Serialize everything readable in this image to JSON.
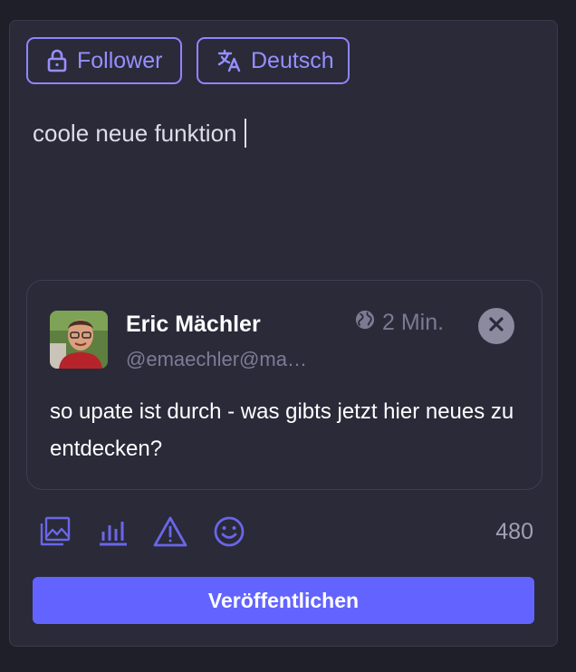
{
  "chips": {
    "visibility": {
      "label": "Follower",
      "icon": "lock-icon"
    },
    "language": {
      "label": "Deutsch",
      "icon": "translate-icon"
    }
  },
  "compose": {
    "value": "coole neue funktion"
  },
  "quoted_post": {
    "author_name": "Eric Mächler",
    "author_handle": "@emaechler@ma…",
    "time": "2 Min.",
    "visibility_icon": "globe-icon",
    "body": "so upate ist durch - was gibts jetzt hier neues  zu entdecken?"
  },
  "toolbar": {
    "icons": [
      "image-icon",
      "poll-icon",
      "warning-icon",
      "emoji-icon"
    ],
    "char_counter": "480"
  },
  "publish": {
    "label": "Veröffentlichen"
  },
  "colors": {
    "accent": "#6364ff",
    "chip_border": "#8f85ff",
    "panel_bg": "#2a2a39",
    "page_bg": "#1f1f29"
  }
}
